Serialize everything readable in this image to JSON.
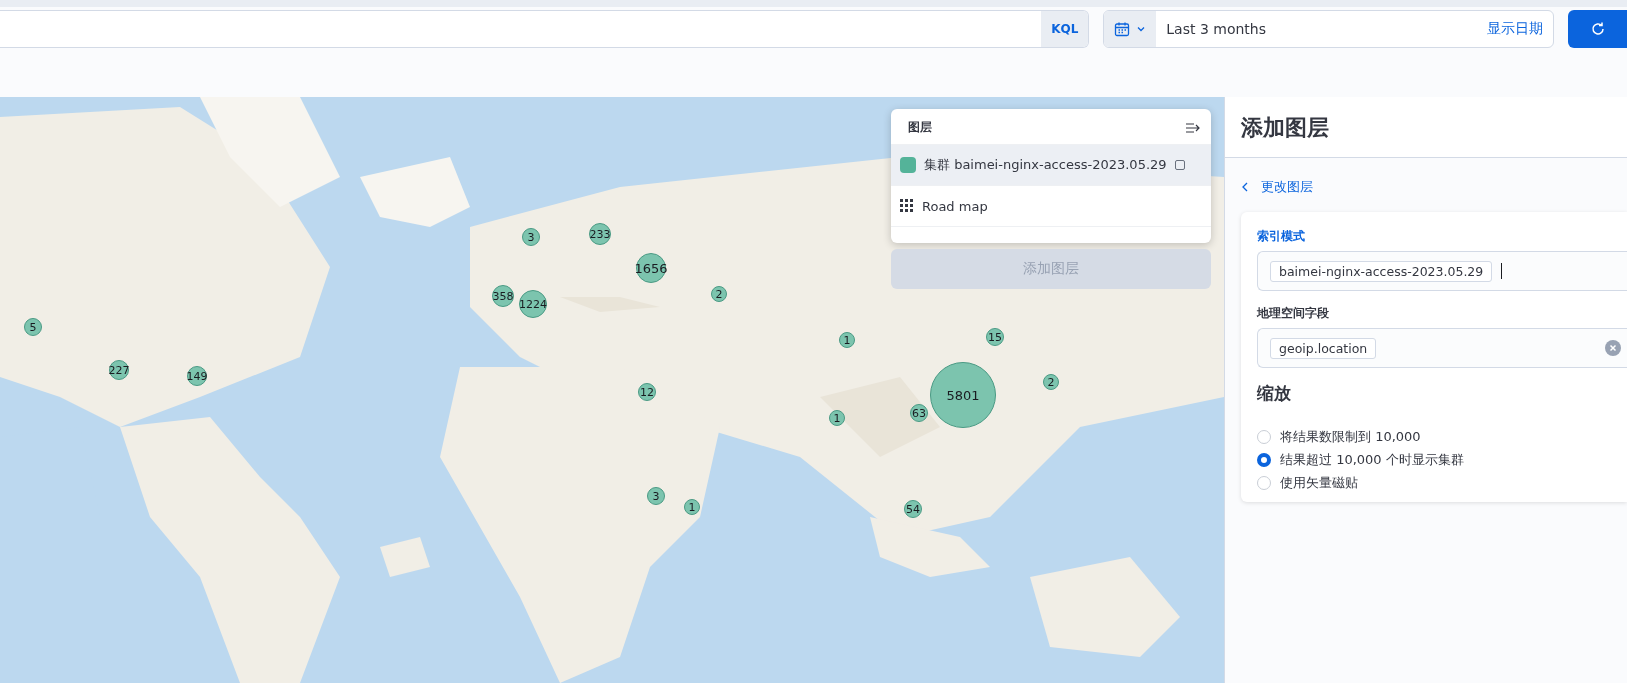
{
  "query_bar": {
    "language": "KQL"
  },
  "date_picker": {
    "value": "Last 3 months",
    "show_dates": "显示日期"
  },
  "map": {
    "clusters": [
      {
        "label": "5"
      },
      {
        "label": "227"
      },
      {
        "label": "149"
      },
      {
        "label": "3"
      },
      {
        "label": "233"
      },
      {
        "label": "1656"
      },
      {
        "label": "358"
      },
      {
        "label": "1224"
      },
      {
        "label": "2"
      },
      {
        "label": "1"
      },
      {
        "label": "15"
      },
      {
        "label": "5801"
      },
      {
        "label": "2"
      },
      {
        "label": "12"
      },
      {
        "label": "63"
      },
      {
        "label": "1"
      },
      {
        "label": "3"
      },
      {
        "label": "1"
      },
      {
        "label": "54"
      }
    ]
  },
  "layers_panel": {
    "title": "图层",
    "layers": [
      {
        "kind": "cluster",
        "name": "集群 baimei-nginx-access-2023.05.29",
        "color": "#54b399",
        "selected": true
      },
      {
        "kind": "tiles",
        "name": "Road map",
        "selected": false
      }
    ],
    "add_button": "添加图层"
  },
  "side_panel": {
    "title": "添加图层",
    "back_link": "更改图层",
    "index_label": "索引模式",
    "index_value": "baimei-nginx-access-2023.05.29",
    "geo_label": "地理空间字段",
    "geo_value": "geoip.location",
    "zoom_title": "缩放",
    "options": [
      {
        "label": "将结果数限制到 10,000",
        "selected": false
      },
      {
        "label": "结果超过 10,000 个时显示集群",
        "selected": true
      },
      {
        "label": "使用矢量磁贴",
        "selected": false
      }
    ]
  }
}
